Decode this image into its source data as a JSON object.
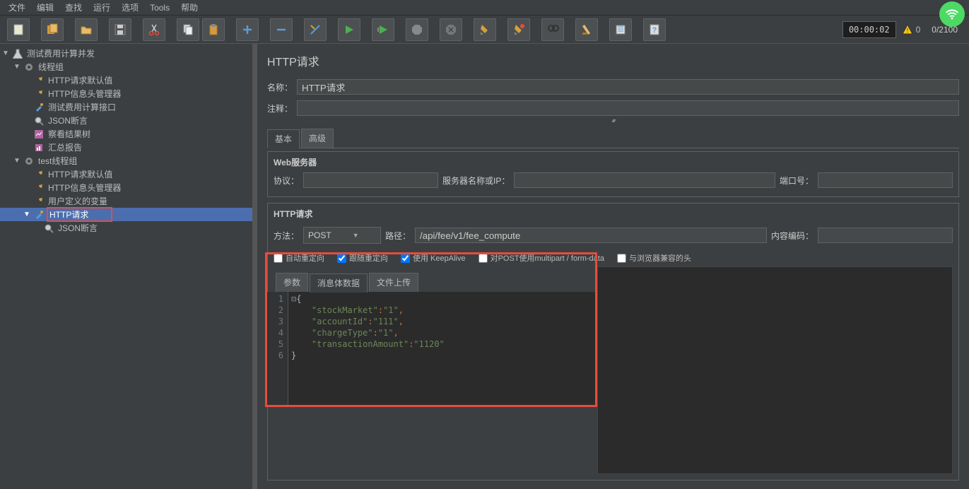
{
  "menu": {
    "file": "文件",
    "edit": "编辑",
    "search": "查找",
    "run": "运行",
    "options": "选项",
    "tools": "Tools",
    "help": "帮助"
  },
  "toolbar": {
    "timer": "00:00:02",
    "warn_count": "0",
    "thread_count": "0/2100"
  },
  "tree": {
    "root": "测试费用计算并发",
    "g1": "线程组",
    "g1_items": [
      "HTTP请求默认值",
      "HTTP信息头管理器",
      "测试费用计算接口",
      "JSON断言",
      "察看结果树",
      "汇总报告"
    ],
    "g2": "test线程组",
    "g2_items": [
      "HTTP请求默认值",
      "HTTP信息头管理器",
      "用户定义的变量",
      "HTTP请求"
    ],
    "g2_sub": "JSON断言"
  },
  "panel": {
    "title": "HTTP请求",
    "name_label": "名称：",
    "name_value": "HTTP请求",
    "comment_label": "注释：",
    "tab_basic": "基本",
    "tab_adv": "高级",
    "webserver": "Web服务器",
    "protocol": "协议：",
    "server": "服务器名称或IP：",
    "port": "端口号：",
    "httpreq": "HTTP请求",
    "method": "方法：",
    "method_v": "POST",
    "path": "路径：",
    "path_v": "/api/fee/v1/fee_compute",
    "encoding": "内容编码：",
    "chk1": "自动重定向",
    "chk2": "跟随重定向",
    "chk3": "使用 KeepAlive",
    "chk4": "对POST使用multipart / form-data",
    "chk5": "与浏览器兼容的头",
    "btab1": "参数",
    "btab2": "消息体数据",
    "btab3": "文件上传",
    "code_lines": [
      "1",
      "2",
      "3",
      "4",
      "5",
      "6"
    ],
    "code_l1": "{",
    "code_k1": "\"stockMarket\"",
    "code_v1": "\"1\"",
    "code_k2": "\"accountId\"",
    "code_v2": "\"111\"",
    "code_k3": "\"chargeType\"",
    "code_v3": "\"1\"",
    "code_k4": "\"transactionAmount\"",
    "code_v4": "\"1120\"",
    "code_l6": "}"
  }
}
